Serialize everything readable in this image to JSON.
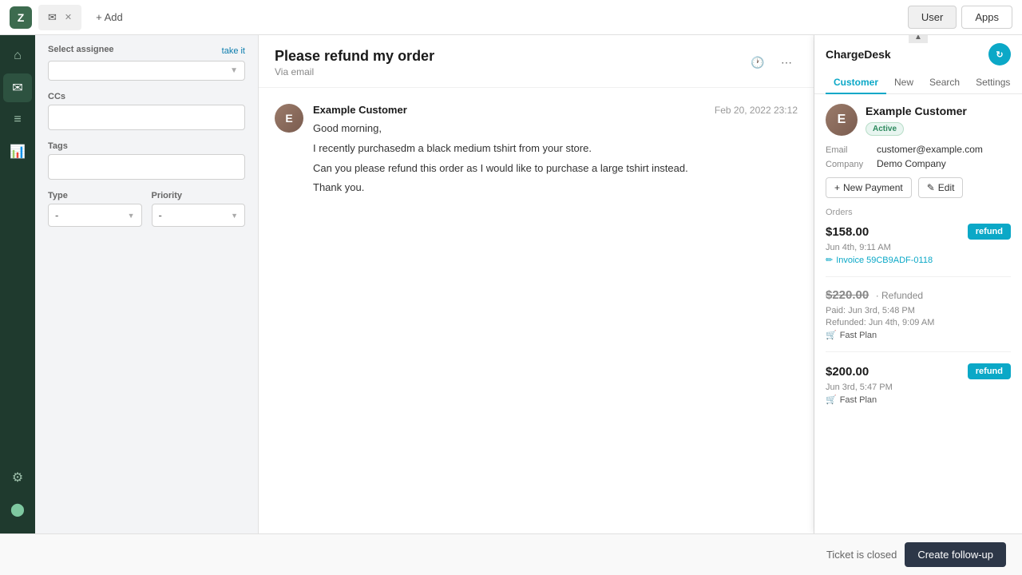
{
  "topBar": {
    "logoText": "Z",
    "tabs": [
      {
        "id": "email-tab",
        "icon": "✉",
        "label": "",
        "active": true
      }
    ],
    "addLabel": "+ Add",
    "userLabel": "User",
    "appsLabel": "Apps"
  },
  "sidebar": {
    "icons": [
      {
        "id": "home",
        "symbol": "⌂",
        "active": false
      },
      {
        "id": "email",
        "symbol": "✉",
        "active": true
      },
      {
        "id": "list",
        "symbol": "☰",
        "active": false
      },
      {
        "id": "chart",
        "symbol": "📊",
        "active": false
      }
    ],
    "bottomIcons": [
      {
        "id": "settings",
        "symbol": "⚙"
      },
      {
        "id": "user",
        "symbol": "👤"
      }
    ]
  },
  "leftPanel": {
    "assignee": {
      "label": "Select assignee",
      "takeItLabel": "take it"
    },
    "ccs": {
      "label": "CCs"
    },
    "tags": {
      "label": "Tags"
    },
    "type": {
      "label": "Type",
      "value": "-"
    },
    "priority": {
      "label": "Priority",
      "value": "-"
    }
  },
  "ticket": {
    "title": "Please refund my order",
    "subtitle": "Via email",
    "sender": "Example Customer",
    "time": "Feb 20, 2022 23:12",
    "avatarInitial": "E",
    "messages": [
      {
        "text": "Good morning,"
      },
      {
        "text": "I recently purchasedm a black medium tshirt from your store."
      },
      {
        "text": "Can you please refund this order as I would like to purchase a large tshirt instead."
      },
      {
        "text": "Thank you."
      }
    ]
  },
  "chargeDesk": {
    "title": "ChargeDesk",
    "iconSymbol": "↻",
    "tabs": [
      {
        "id": "customer",
        "label": "Customer",
        "active": true
      },
      {
        "id": "new",
        "label": "New",
        "active": false
      },
      {
        "id": "search",
        "label": "Search",
        "active": false
      },
      {
        "id": "settings",
        "label": "Settings",
        "active": false
      }
    ],
    "customer": {
      "name": "Example Customer",
      "avatarInitial": "E",
      "status": "Active",
      "email": {
        "key": "Email",
        "value": "customer@example.com"
      },
      "company": {
        "key": "Company",
        "value": "Demo Company"
      },
      "newPaymentLabel": "+ New Payment",
      "editLabel": "✎ Edit"
    },
    "orders": {
      "sectionLabel": "Orders",
      "items": [
        {
          "amount": "$158.00",
          "refunded": false,
          "refundedLabel": "",
          "showRefundBtn": true,
          "refundBtnLabel": "refund",
          "date": "Jun 4th, 9:11 AM",
          "invoice": "Invoice 59CB9ADF-0118",
          "plan": null
        },
        {
          "amount": "$220.00",
          "refunded": true,
          "refundedLabel": "· Refunded",
          "showRefundBtn": false,
          "refundBtnLabel": "",
          "date": "Paid: Jun 3rd, 5:48 PM",
          "date2": "Refunded: Jun 4th, 9:09 AM",
          "invoice": null,
          "plan": "Fast Plan"
        },
        {
          "amount": "$200.00",
          "refunded": false,
          "refundedLabel": "",
          "showRefundBtn": true,
          "refundBtnLabel": "refund",
          "date": "Jun 3rd, 5:47 PM",
          "invoice": null,
          "plan": "Fast Plan"
        }
      ]
    }
  },
  "bottomBar": {
    "statusText": "Ticket is closed",
    "createFollowUpLabel": "Create follow-up"
  }
}
